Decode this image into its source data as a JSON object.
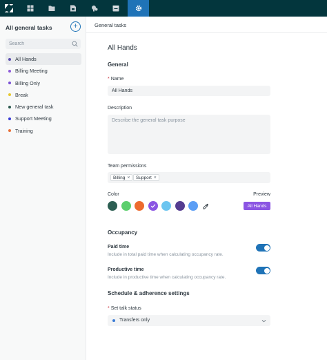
{
  "sidebar": {
    "title": "All general tasks",
    "add_label": "+",
    "search_placeholder": "Search",
    "items": [
      {
        "label": "All Hands",
        "color": "#5d4eb0",
        "selected": true
      },
      {
        "label": "Billing Meeting",
        "color": "#8f5cd9",
        "selected": false
      },
      {
        "label": "Billing Only",
        "color": "#7b52d6",
        "selected": false
      },
      {
        "label": "Break",
        "color": "#e7c82e",
        "selected": false
      },
      {
        "label": "New general task",
        "color": "#2d5a50",
        "selected": false
      },
      {
        "label": "Support Meeting",
        "color": "#3a3dd6",
        "selected": false
      },
      {
        "label": "Training",
        "color": "#e8703a",
        "selected": false
      }
    ]
  },
  "header": {
    "breadcrumb": "General tasks"
  },
  "form": {
    "title": "All Hands",
    "general_heading": "General",
    "name_required": "*",
    "name_label": "Name",
    "name_value": "All Hands",
    "description_label": "Description",
    "description_placeholder": "Describe the general task purpose",
    "permissions_label": "Team permissions",
    "permission_tags": [
      {
        "label": "Billing",
        "remove": "×"
      },
      {
        "label": "Support",
        "remove": "×"
      }
    ],
    "color_label": "Color",
    "preview_label": "Preview",
    "preview_badge": "All Hands",
    "preview_color": "#8b55e3",
    "colors": [
      "#2c5e52",
      "#5ccf6d",
      "#ed6b2e",
      "#8b55e3",
      "#6cc5f0",
      "#553d91",
      "#5b9ef5"
    ],
    "selected_color_index": 3,
    "occupancy_heading": "Occupancy",
    "paid_time_label": "Paid time",
    "paid_time_hint": "Include in total paid time when calculating occupancy rate.",
    "paid_time_on": true,
    "productive_time_label": "Productive time",
    "productive_time_hint": "Include in productive time when calculating occupancy rate.",
    "productive_time_on": true,
    "schedule_heading": "Schedule & adherence settings",
    "talk_status_required": "*",
    "talk_status_label": "Set talk status",
    "talk_status_value": "Transfers only",
    "talk_status_dot_color": "#3a7bd5"
  },
  "nav": {
    "icons": [
      "logo-icon",
      "dashboard-icon",
      "folder-icon",
      "calendar-icon",
      "cog-people-icon",
      "schedule-icon",
      "settings-icon"
    ],
    "active_index": 5,
    "accent": "#1f73b7",
    "bar_color": "#03363d"
  }
}
